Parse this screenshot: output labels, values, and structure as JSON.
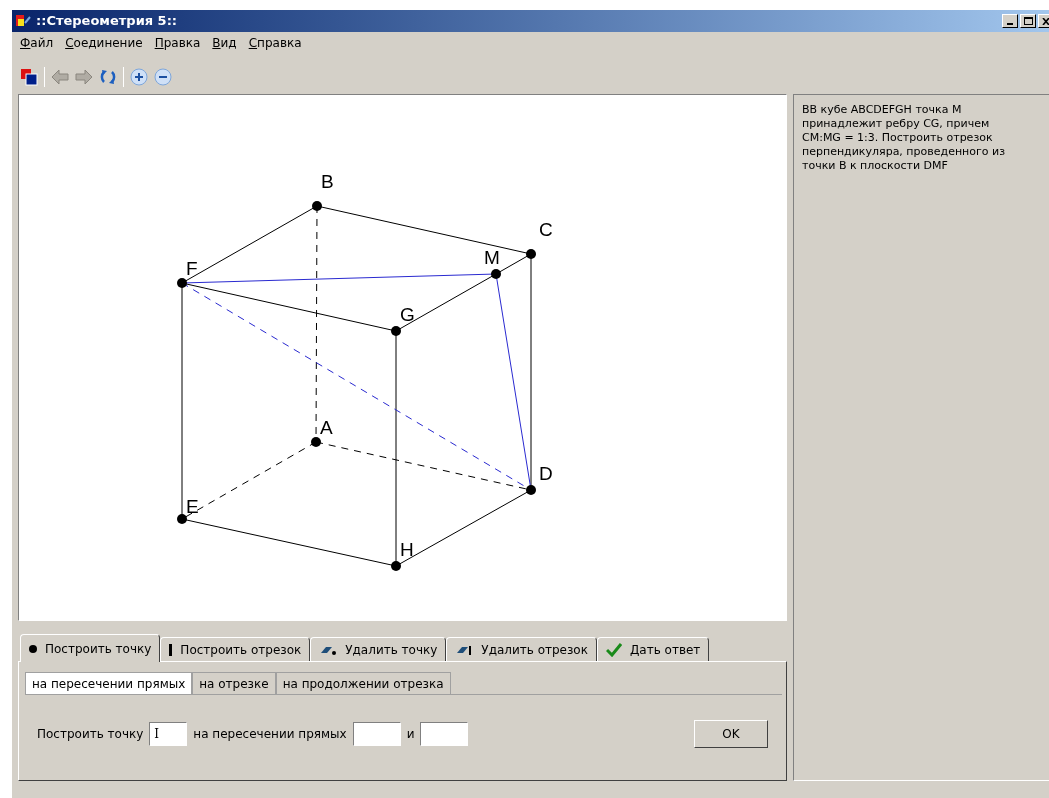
{
  "window": {
    "title": "::Стереометрия 5::"
  },
  "menu": [
    "Файл",
    "Соединение",
    "Правка",
    "Вид",
    "Справка"
  ],
  "points": [
    "B",
    "C",
    "M",
    "F",
    "G",
    "A",
    "D",
    "E",
    "H"
  ],
  "task": "ВВ кубе ABCDEFGH точка М принадлежит ребру CG, причем CM:MG = 1:3. Построить отрезок перпендикуляра, проведенного из точки В к плоскости DMF",
  "tabs": [
    {
      "label": "Построить точку",
      "kind": "point",
      "selected": true
    },
    {
      "label": "Построить отрезок",
      "kind": "segment",
      "selected": false
    },
    {
      "label": "Удалить точку",
      "kind": "delete-point",
      "selected": false
    },
    {
      "label": "Удалить отрезок",
      "kind": "delete-segment",
      "selected": false
    },
    {
      "label": "Дать ответ",
      "kind": "answer",
      "selected": false
    }
  ],
  "subtabs": [
    {
      "label": "на пересечении прямых",
      "selected": true
    },
    {
      "label": "на отрезке",
      "selected": false
    },
    {
      "label": "на продолжении отрезка",
      "selected": false
    }
  ],
  "form": {
    "label": "Построить точку",
    "point_value": "I",
    "middle_label": "на пересечении прямых",
    "conj": "и",
    "ok": "OK"
  }
}
